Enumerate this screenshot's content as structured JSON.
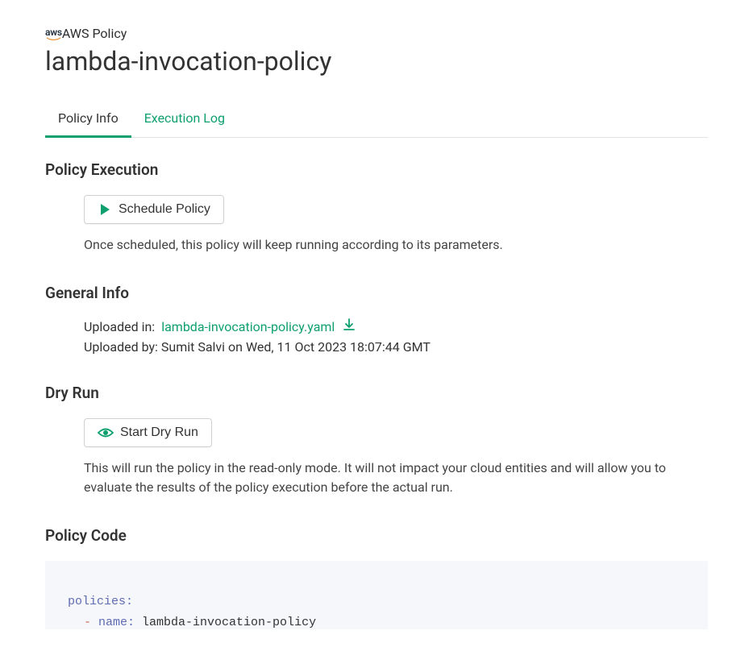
{
  "breadcrumb": {
    "label": "AWS Policy"
  },
  "page_title": "lambda-invocation-policy",
  "tabs": {
    "policy_info": "Policy Info",
    "execution_log": "Execution Log"
  },
  "sections": {
    "policy_execution": {
      "title": "Policy Execution",
      "button_label": "Schedule Policy",
      "description": "Once scheduled, this policy will keep running according to its parameters."
    },
    "general_info": {
      "title": "General Info",
      "uploaded_in_label": "Uploaded in:",
      "file_name": "lambda-invocation-policy.yaml",
      "uploaded_by": "Uploaded by: Sumit Salvi on Wed, 11 Oct 2023 18:07:44 GMT"
    },
    "dry_run": {
      "title": "Dry Run",
      "button_label": "Start Dry Run",
      "description": "This will run the policy in the read-only mode. It will not impact your cloud entities and will allow you to evaluate the results of the policy execution before the actual run."
    },
    "policy_code": {
      "title": "Policy Code",
      "code": {
        "key1": "policies:",
        "dash": "- ",
        "key2": "name:",
        "val": " lambda-invocation-policy"
      }
    }
  }
}
